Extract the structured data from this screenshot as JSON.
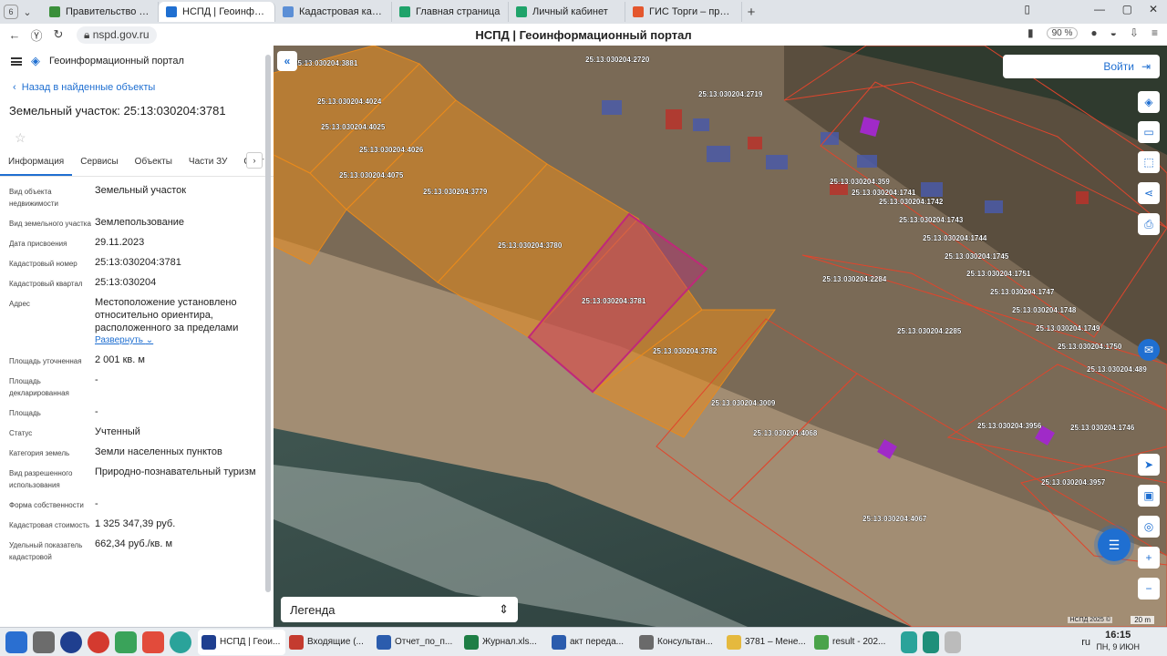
{
  "browser": {
    "tab_counter": "6",
    "tabs": [
      {
        "label": "Правительство Приморс",
        "color": "#3a8f3a"
      },
      {
        "label": "НСПД | Геоинформацио",
        "color": "#1f6fd1",
        "active": true
      },
      {
        "label": "Кадастровая карта Сиби",
        "color": "#5c8fd6"
      },
      {
        "label": "Главная страница",
        "color": "#1fa36a"
      },
      {
        "label": "Личный кабинет",
        "color": "#1fa36a"
      },
      {
        "label": "ГИС Торги – продажи гос",
        "color": "#e4572e"
      }
    ],
    "url": "nspd.gov.ru",
    "page_title": "НСПД | Геоинформационный портал",
    "zoom": "90 %"
  },
  "panel": {
    "portal_name": "Геоинформационный портал",
    "back_link": "Назад в найденные объекты",
    "title": "Земельный участок: 25:13:030204:3781",
    "tabs": [
      "Информация",
      "Сервисы",
      "Объекты",
      "Части ЗУ",
      "Сост"
    ],
    "fields": [
      {
        "k": "Вид объекта недвижимости",
        "v": "Земельный участок"
      },
      {
        "k": "Вид земельного участка",
        "v": "Землепользование"
      },
      {
        "k": "Дата присвоения",
        "v": "29.11.2023"
      },
      {
        "k": "Кадастровый номер",
        "v": "25:13:030204:3781"
      },
      {
        "k": "Кадастровый квартал",
        "v": "25:13:030204"
      },
      {
        "k": "Адрес",
        "v": "Местоположение установлено относительно ориентира, расположенного за пределами"
      },
      {
        "k": "Площадь уточненная",
        "v": "2 001 кв. м"
      },
      {
        "k": "Площадь декларированная",
        "v": "-"
      },
      {
        "k": "Площадь",
        "v": "-"
      },
      {
        "k": "Статус",
        "v": "Учтенный"
      },
      {
        "k": "Категория земель",
        "v": "Земли населенных пунктов"
      },
      {
        "k": "Вид разрешенного использования",
        "v": "Природно-познавательный туризм"
      },
      {
        "k": "Форма собственности",
        "v": "-"
      },
      {
        "k": "Кадастровая стоимость",
        "v": "1 325 347,39 руб."
      },
      {
        "k": "Удельный показатель кадастровой",
        "v": "662,34 руб./кв. м"
      }
    ],
    "expand_label": "Развернуть"
  },
  "map": {
    "login_label": "Войти",
    "legend_label": "Легенда",
    "scale": "20 m",
    "copyright": "НСПД 2025 ©",
    "parcels": [
      "25:13:030204:3881",
      "25:13:030204:4024",
      "25:13:030204:4025",
      "25:13:030204:4026",
      "25:13:030204:4075",
      "25:13:030204:3779",
      "25:13:030204:3780",
      "25:13:030204:3781",
      "25:13:030204:3782",
      "25:13:030204:3009",
      "25:13:030204:4068",
      "25:13:030204:4067",
      "25:13:030204:2720",
      "25:13:030204:2719",
      "25:13:030204:359",
      "25:13:030204:1741",
      "25:13:030204:1742",
      "25:13:030204:1743",
      "25:13:030204:1744",
      "25:13:030204:1745",
      "25:13:030204:1751",
      "25:13:030204:1747",
      "25:13:030204:1748",
      "25:13:030204:1749",
      "25:13:030204:1750",
      "25:13:030204:2284",
      "25:13:030204:2285",
      "25:13:030204:489",
      "25:13:030204:3956",
      "25:13:030204:1746",
      "25:13:030204:3957"
    ],
    "colors": {
      "selected": "#c0287a",
      "neighbor": "#e88a1c",
      "other": "#e0452c"
    }
  },
  "taskbar": {
    "items": [
      {
        "label": "НСПД | Геои...",
        "color": "#1f3f8f",
        "active": true
      },
      {
        "label": "Входящие (...",
        "color": "#c43b2f"
      },
      {
        "label": "Отчет_по_п...",
        "color": "#2b5cad"
      },
      {
        "label": "Журнал.xls...",
        "color": "#1e7e45"
      },
      {
        "label": "акт переда...",
        "color": "#2b5cad"
      },
      {
        "label": "Консультан...",
        "color": "#6a6a6a"
      },
      {
        "label": "3781 – Мене...",
        "color": "#e5b93e"
      },
      {
        "label": "result - 202...",
        "color": "#4aa34a"
      }
    ],
    "lang": "ru",
    "time": "16:15",
    "date": "ПН, 9 ИЮН"
  }
}
